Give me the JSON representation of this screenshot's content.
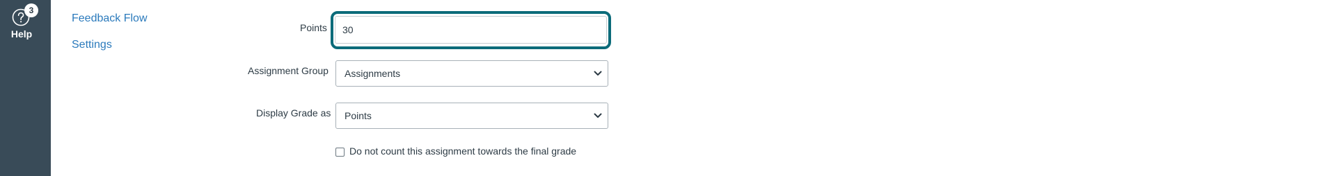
{
  "global_nav": {
    "help": {
      "label": "Help",
      "badge_count": "3",
      "icon": "question-circle-icon"
    }
  },
  "sidebar_links": [
    {
      "label": "Feedback Flow"
    },
    {
      "label": "Settings"
    }
  ],
  "form": {
    "points": {
      "label": "Points",
      "value": "30"
    },
    "assignment_group": {
      "label": "Assignment Group",
      "selected": "Assignments"
    },
    "display_grade_as": {
      "label": "Display Grade as",
      "selected": "Points"
    },
    "omit_from_final_grade": {
      "label": "Do not count this assignment towards the final grade",
      "checked": false
    }
  },
  "colors": {
    "nav_background": "#394b58",
    "link": "#2b7abc",
    "focus_ring": "#0c6b7a",
    "text": "#2d3b45"
  }
}
